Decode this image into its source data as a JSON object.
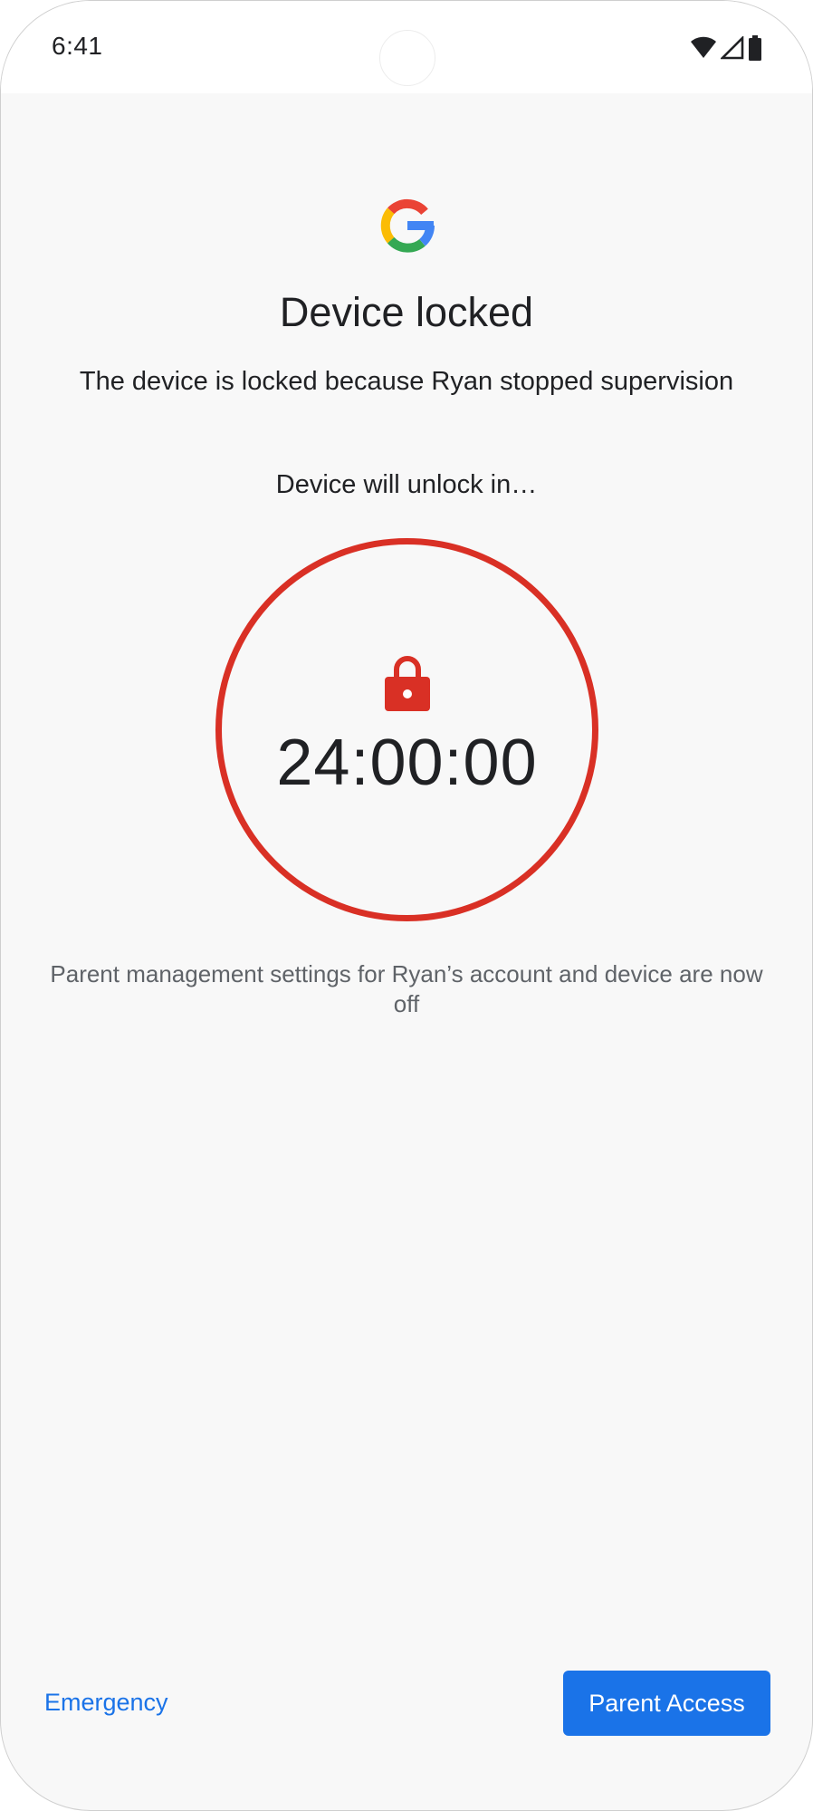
{
  "status_bar": {
    "time": "6:41",
    "icons": [
      "wifi-icon",
      "cell-signal-icon",
      "battery-icon"
    ]
  },
  "header": {
    "logo": "google-g-icon",
    "title": "Device locked",
    "subtitle": "The device is locked because Ryan stopped supervision"
  },
  "countdown": {
    "label": "Device will unlock in…",
    "icon": "lock-icon",
    "value": "24:00:00"
  },
  "info": {
    "text": "Parent management settings for Ryan’s account and device are now off"
  },
  "actions": {
    "emergency_label": "Emergency",
    "parent_access_label": "Parent Access"
  },
  "colors": {
    "accent": "#1a73e8",
    "ring": "#d93025",
    "background": "#f8f8f8",
    "text_primary": "#202124",
    "text_secondary": "#5f6368"
  }
}
